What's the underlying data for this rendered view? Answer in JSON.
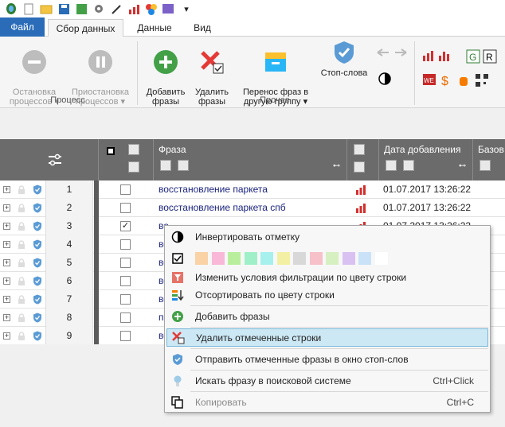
{
  "tabs": {
    "file": "Файл",
    "active": "Сбор данных",
    "data": "Данные",
    "view": "Вид"
  },
  "ribbon": {
    "stop": "Остановка\nпроцессов ▾",
    "pause": "Приостановка\nпроцессов ▾",
    "process_group": "Процесс",
    "add": "Добавить\nфразы",
    "delete": "Удалить\nфразы",
    "move": "Перенос фраз в\nдругую группу ▾",
    "stopwords": "Стоп-слова",
    "other_group": "Прочее"
  },
  "grid": {
    "header_phrase": "Фраза",
    "header_date": "Дата добавления",
    "header_base": "Базов",
    "rows": [
      {
        "num": "1",
        "phrase": "восстановление паркета",
        "checked": "",
        "date": "01.07.2017 13:26:22"
      },
      {
        "num": "2",
        "phrase": "восстановление паркета спб",
        "checked": "",
        "date": "01.07.2017 13:26:22"
      },
      {
        "num": "3",
        "phrase": "во",
        "checked": "✓",
        "date": "01.07.2017 13:26:22"
      },
      {
        "num": "4",
        "phrase": "во",
        "checked": "",
        "date": ""
      },
      {
        "num": "5",
        "phrase": "во",
        "checked": "",
        "date": ""
      },
      {
        "num": "6",
        "phrase": "во",
        "checked": "",
        "date": ""
      },
      {
        "num": "7",
        "phrase": "во",
        "checked": "",
        "date": ""
      },
      {
        "num": "8",
        "phrase": "п",
        "checked": "",
        "date": ""
      },
      {
        "num": "9",
        "phrase": "во",
        "checked": "",
        "date": ""
      }
    ]
  },
  "menu": {
    "invert": "Инвертировать отметку",
    "filter_color": "Изменить условия фильтрации по цвету строки",
    "sort_color": "Отсортировать по цвету строки",
    "add_phrases": "Добавить фразы",
    "delete_marked": "Удалить отмеченные строки",
    "send_stop": "Отправить отмеченные фразы в окно стоп-слов",
    "search": "Искать фразу в поисковой системе",
    "search_shortcut": "Ctrl+Click",
    "copy": "Копировать",
    "copy_shortcut": "Ctrl+C",
    "swatches": [
      "#f9d2a6",
      "#f9b8d8",
      "#b9ef9c",
      "#9ff0c8",
      "#a6f0ee",
      "#f4f0a3",
      "#d8d8d8",
      "#f7c1c9",
      "#d7f0c2",
      "#d9c2f2",
      "#c9e2f7",
      "#ffffff"
    ]
  }
}
